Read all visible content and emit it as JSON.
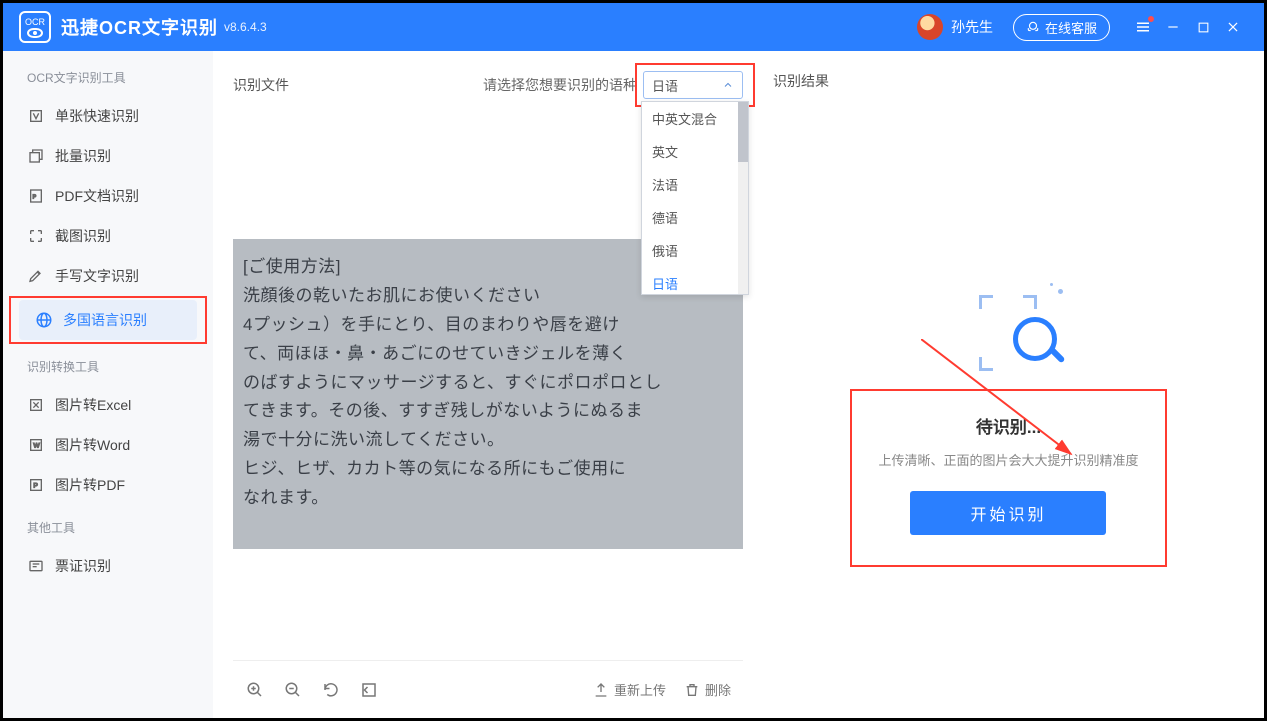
{
  "titlebar": {
    "logo_sub": "OCR",
    "app_name": "迅捷OCR文字识别",
    "version": "v8.6.4.3",
    "username": "孙先生",
    "customer_service": "在线客服"
  },
  "sidebar": {
    "section_ocr": "OCR文字识别工具",
    "single": "单张快速识别",
    "batch": "批量识别",
    "pdf": "PDF文档识别",
    "screenshot": "截图识别",
    "handwrite": "手写文字识别",
    "multilang": "多国语言识别",
    "section_convert": "识别转换工具",
    "excel": "图片转Excel",
    "word": "图片转Word",
    "topdf": "图片转PDF",
    "section_other": "其他工具",
    "ticket": "票证识别"
  },
  "leftpane": {
    "title": "识别文件",
    "lang_label": "请选择您想要识别的语种",
    "lang_selected": "日语",
    "lang_options": [
      "中英文混合",
      "英文",
      "法语",
      "德语",
      "俄语",
      "日语"
    ],
    "preview_text": "[ご使用方法]\n洗顔後の乾いたお肌にお使いください\n4プッシュ）を手にとり、目のまわりや唇を避け\nて、両ほほ・鼻・あごにのせていきジェルを薄く\nのばすようにマッサージすると、すぐにポロポロとし\nてきます。その後、すすぎ残しがないようにぬるま\n湯で十分に洗い流してください。\nヒジ、ヒザ、カカト等の気になる所にもご使用に\nなれます。"
  },
  "toolbar": {
    "reupload": "重新上传",
    "delete": "删除"
  },
  "rightpane": {
    "title": "识别结果",
    "placeholder_title": "待识别...",
    "placeholder_hint": "上传清晰、正面的图片会大大提升识别精准度",
    "start_btn": "开始识别"
  }
}
